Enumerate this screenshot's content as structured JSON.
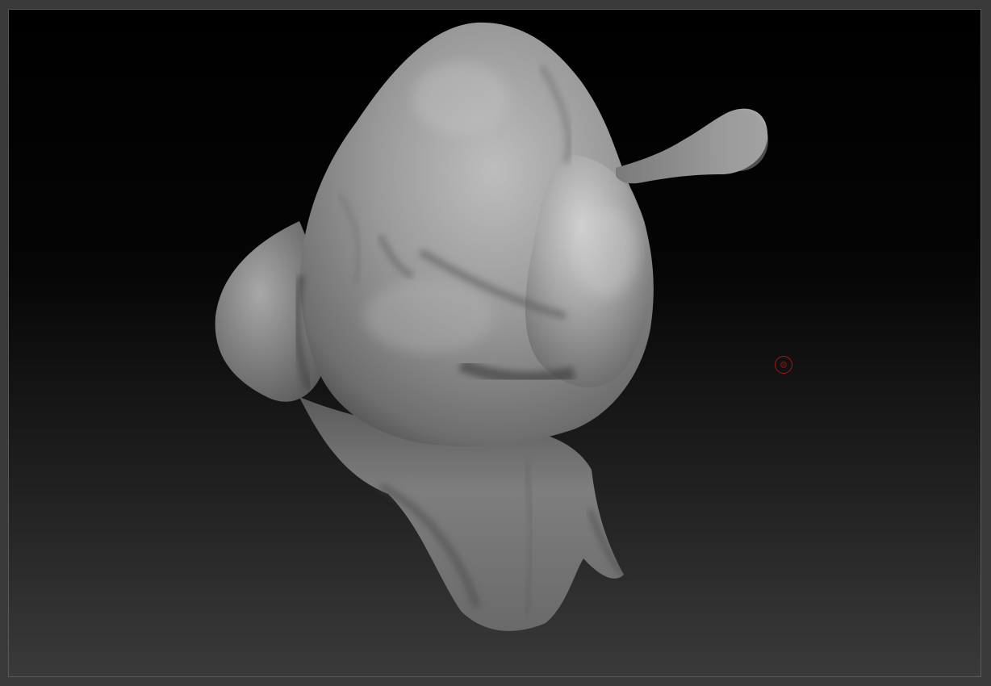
{
  "viewport": {
    "background_top": "#000000",
    "background_bottom": "#3a3a3a",
    "frame_border": "#5a5a5a"
  },
  "model": {
    "material_color": "#8c8c8c",
    "highlight_color": "#c4c4c4",
    "shadow_color": "#2a2a2a"
  },
  "brush_cursor": {
    "color": "#a01818",
    "icon": "brush-circle-icon"
  }
}
